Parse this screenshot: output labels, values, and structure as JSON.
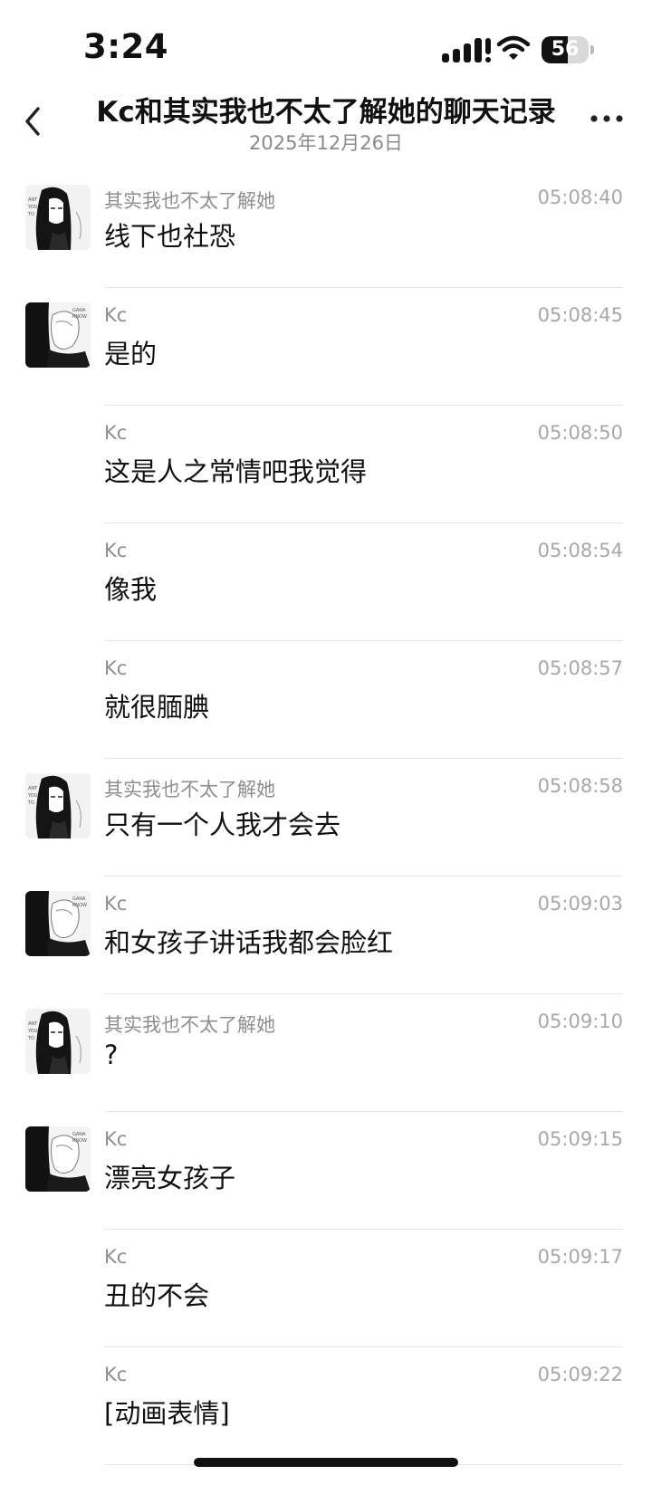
{
  "status_bar": {
    "time": "3:24",
    "battery_level": "56",
    "battery_fraction": 0.56,
    "icons": [
      "signal-icon",
      "wifi-icon",
      "battery-icon"
    ]
  },
  "header": {
    "title": "Kc和其实我也不太了解她的聊天记录",
    "date": "2025年12月26日",
    "back_icon": "chevron-left-icon",
    "more_icon": "more-horizontal-icon"
  },
  "messages": [
    {
      "sender": "其实我也不太了解她",
      "time": "05:08:40",
      "text": "线下也社恐",
      "avatar": "avatar-girl-dark-hair"
    },
    {
      "sender": "Kc",
      "time": "05:08:45",
      "text": "是的",
      "avatar": "avatar-manga-couple"
    },
    {
      "sender": "Kc",
      "time": "05:08:50",
      "text": "这是人之常情吧我觉得",
      "avatar": ""
    },
    {
      "sender": "Kc",
      "time": "05:08:54",
      "text": "像我",
      "avatar": ""
    },
    {
      "sender": "Kc",
      "time": "05:08:57",
      "text": "就很腼腆",
      "avatar": ""
    },
    {
      "sender": "其实我也不太了解她",
      "time": "05:08:58",
      "text": "只有一个人我才会去",
      "avatar": "avatar-girl-dark-hair"
    },
    {
      "sender": "Kc",
      "time": "05:09:03",
      "text": "和女孩子讲话我都会脸红",
      "avatar": "avatar-manga-couple"
    },
    {
      "sender": "其实我也不太了解她",
      "time": "05:09:10",
      "text": "?",
      "avatar": "avatar-girl-dark-hair"
    },
    {
      "sender": "Kc",
      "time": "05:09:15",
      "text": "漂亮女孩子",
      "avatar": "avatar-manga-couple"
    },
    {
      "sender": "Kc",
      "time": "05:09:17",
      "text": "丑的不会",
      "avatar": ""
    },
    {
      "sender": "Kc",
      "time": "05:09:22",
      "text": "[动画表情]",
      "avatar": ""
    }
  ]
}
